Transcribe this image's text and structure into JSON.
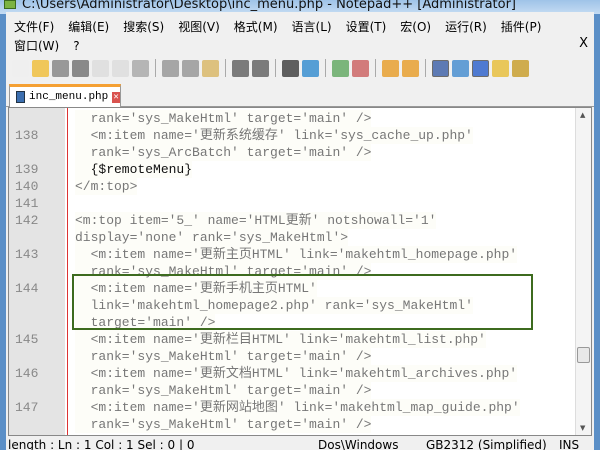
{
  "window": {
    "title": "C:\\Users\\Administrator\\Desktop\\inc_menu.php - Notepad++ [Administrator]"
  },
  "menu": {
    "row1": [
      "文件(F)",
      "编辑(E)",
      "搜索(S)",
      "视图(V)",
      "格式(M)",
      "语言(L)",
      "设置(T)",
      "宏(O)",
      "运行(R)",
      "插件(P)"
    ],
    "row2": [
      "窗口(W)",
      "?"
    ],
    "close": "X"
  },
  "tab": {
    "label": "inc_menu.php"
  },
  "lines": [
    {
      "n": "",
      "t": "  rank='sys_MakeHtml' target='main' />"
    },
    {
      "n": "138",
      "t": "  <m:item name='更新系统缓存' link='sys_cache_up.php'"
    },
    {
      "n": "",
      "t": "  rank='sys_ArcBatch' target='main' />"
    },
    {
      "n": "139",
      "t": "  {$remoteMenu}",
      "dark": true
    },
    {
      "n": "140",
      "t": "</m:top>"
    },
    {
      "n": "141",
      "t": ""
    },
    {
      "n": "142",
      "t": "<m:top item='5_' name='HTML更新' notshowall='1'"
    },
    {
      "n": "",
      "t": "display='none' rank='sys_MakeHtml'>"
    },
    {
      "n": "143",
      "t": "  <m:item name='更新主页HTML' link='makehtml_homepage.php'"
    },
    {
      "n": "",
      "t": "  rank='sys_MakeHtml' target='main' />"
    },
    {
      "n": "144",
      "t": "  <m:item name='更新手机主页HTML'"
    },
    {
      "n": "",
      "t": "  link='makehtml_homepage2.php' rank='sys_MakeHtml'"
    },
    {
      "n": "",
      "t": "  target='main' />"
    },
    {
      "n": "145",
      "t": "  <m:item name='更新栏目HTML' link='makehtml_list.php'"
    },
    {
      "n": "",
      "t": "  rank='sys_MakeHtml' target='main' />"
    },
    {
      "n": "146",
      "t": "  <m:item name='更新文档HTML' link='makehtml_archives.php'"
    },
    {
      "n": "",
      "t": "  rank='sys_MakeHtml' target='main' />"
    },
    {
      "n": "147",
      "t": "  <m:item name='更新网站地图' link='makehtml_map_guide.php'"
    },
    {
      "n": "",
      "t": "  rank='sys_MakeHtml' target='main' />"
    }
  ],
  "status": {
    "position": "length : Ln : 1    Col : 1    Sel : 0 | 0",
    "eol": "Dos\\Windows",
    "encoding": "GB2312 (Simplified)",
    "mode": "INS"
  }
}
